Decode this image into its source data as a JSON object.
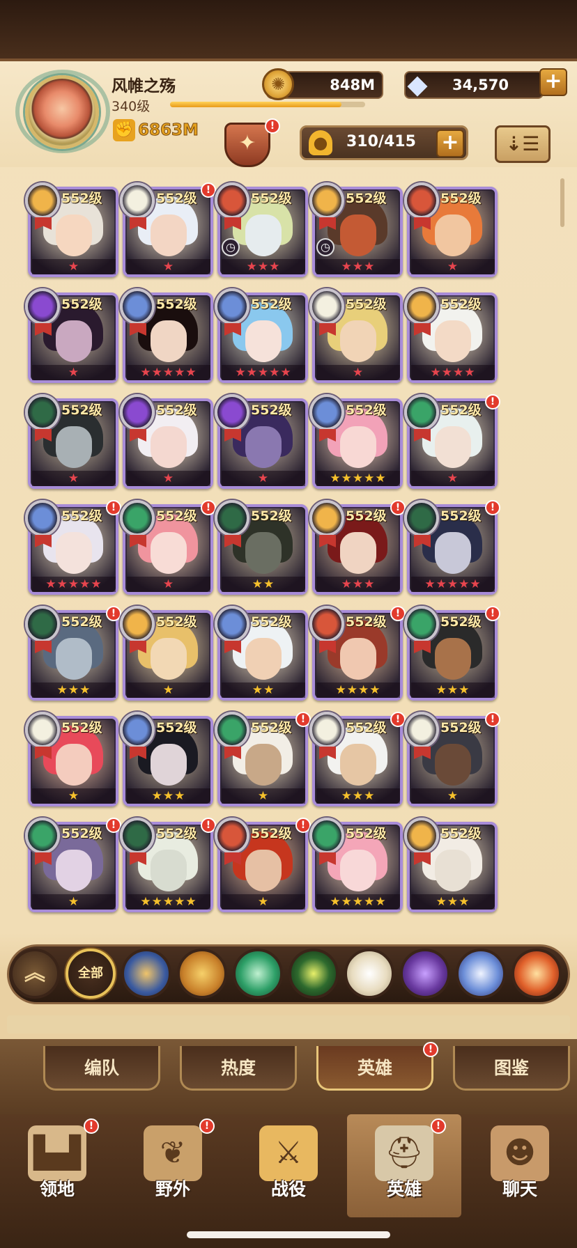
{
  "player": {
    "name": "风帷之殇",
    "level": "340级",
    "xp_fraction": 0.88,
    "power": "6863M"
  },
  "resources": {
    "gold": "848M",
    "diamonds": "34,570",
    "gold_icon": "gold-coin-icon",
    "diamond_icon": "diamond-icon"
  },
  "hero_count": "310/415",
  "faction_colors": {
    "lightbearer": "#f0b44a",
    "mauler": "#d8563a",
    "wilder": "#3aa468",
    "graveborn": "#8a4ad0",
    "celestial": "#f3f0e0",
    "hypogean": "#6a3aa0",
    "dimensional": "#6c8ed8",
    "dragon": "#2f6a46"
  },
  "heroes": [
    {
      "level": "552级",
      "stars": "★",
      "star_color": "red",
      "faction": "lightbearer",
      "badge": false,
      "clock": false,
      "skin": "#f6d7c0",
      "hair": "#e8e2d8"
    },
    {
      "level": "552级",
      "stars": "★",
      "star_color": "red",
      "faction": "celestial",
      "badge": true,
      "clock": false,
      "skin": "#f3d6c4",
      "hair": "#e9eef6"
    },
    {
      "level": "552级",
      "stars": "★★★",
      "star_color": "red",
      "faction": "mauler",
      "badge": false,
      "clock": true,
      "skin": "#e6ecee",
      "hair": "#d8e2a8"
    },
    {
      "level": "552级",
      "stars": "★★★",
      "star_color": "red",
      "faction": "lightbearer",
      "badge": false,
      "clock": true,
      "skin": "#c45a34",
      "hair": "#5a3a2a"
    },
    {
      "level": "552级",
      "stars": "★",
      "star_color": "red",
      "faction": "mauler",
      "badge": false,
      "clock": false,
      "skin": "#f1c6a0",
      "hair": "#e87a3a"
    },
    {
      "level": "552级",
      "stars": "★",
      "star_color": "red",
      "faction": "graveborn",
      "badge": false,
      "clock": false,
      "skin": "#c9a8c0",
      "hair": "#2a1a2e"
    },
    {
      "level": "552级",
      "stars": "★★★★★",
      "star_color": "red",
      "faction": "dimensional",
      "badge": false,
      "clock": false,
      "skin": "#f0d6c4",
      "hair": "#1a0e0e"
    },
    {
      "level": "552级",
      "stars": "★★★★★",
      "star_color": "red",
      "faction": "dimensional",
      "badge": false,
      "clock": false,
      "skin": "#f6e2da",
      "hair": "#8ac8ee"
    },
    {
      "level": "552级",
      "stars": "★",
      "star_color": "red",
      "faction": "celestial",
      "badge": false,
      "clock": false,
      "skin": "#f1d4b6",
      "hair": "#e8cf7a"
    },
    {
      "level": "552级",
      "stars": "★★★★",
      "star_color": "red",
      "faction": "lightbearer",
      "badge": false,
      "clock": false,
      "skin": "#f3dac6",
      "hair": "#f2f2ee"
    },
    {
      "level": "552级",
      "stars": "★",
      "star_color": "red",
      "faction": "dragon",
      "badge": false,
      "clock": false,
      "skin": "#a8b0b4",
      "hair": "#2a2e30"
    },
    {
      "level": "552级",
      "stars": "★",
      "star_color": "red",
      "faction": "graveborn",
      "badge": false,
      "clock": false,
      "skin": "#f4d8d0",
      "hair": "#f2eef2"
    },
    {
      "level": "552级",
      "stars": "★",
      "star_color": "red",
      "faction": "graveborn",
      "badge": false,
      "clock": false,
      "skin": "#8a78b0",
      "hair": "#3a2a5e"
    },
    {
      "level": "552级",
      "stars": "★★★★★",
      "star_color": "gold",
      "faction": "dimensional",
      "badge": false,
      "clock": false,
      "skin": "#f8d8d4",
      "hair": "#f2a2b8"
    },
    {
      "level": "552级",
      "stars": "★",
      "star_color": "red",
      "faction": "wilder",
      "badge": true,
      "clock": false,
      "skin": "#f2e0d4",
      "hair": "#e8f0ee"
    },
    {
      "level": "552级",
      "stars": "★★★★★",
      "star_color": "red",
      "faction": "dimensional",
      "badge": true,
      "clock": false,
      "skin": "#f4e2dc",
      "hair": "#e8e4ee"
    },
    {
      "level": "552级",
      "stars": "★",
      "star_color": "red",
      "faction": "wilder",
      "badge": true,
      "clock": false,
      "skin": "#f8dcd6",
      "hair": "#f0949e"
    },
    {
      "level": "552级",
      "stars": "★★",
      "star_color": "gold",
      "faction": "dragon",
      "badge": false,
      "clock": false,
      "skin": "#6a6e62",
      "hair": "#2e3228"
    },
    {
      "level": "552级",
      "stars": "★★★",
      "star_color": "red",
      "faction": "lightbearer",
      "badge": true,
      "clock": false,
      "skin": "#f0d4c2",
      "hair": "#7a1a1a"
    },
    {
      "level": "552级",
      "stars": "★★★★★",
      "star_color": "red",
      "faction": "dragon",
      "badge": true,
      "clock": false,
      "skin": "#c8c8d8",
      "hair": "#2a2e4a"
    },
    {
      "level": "552级",
      "stars": "★★★",
      "star_color": "gold",
      "faction": "dragon",
      "badge": true,
      "clock": false,
      "skin": "#b0bcc8",
      "hair": "#5a6a80"
    },
    {
      "level": "552级",
      "stars": "★",
      "star_color": "gold",
      "faction": "lightbearer",
      "badge": false,
      "clock": false,
      "skin": "#f2d8b4",
      "hair": "#e8c06a"
    },
    {
      "level": "552级",
      "stars": "★★",
      "star_color": "gold",
      "faction": "dimensional",
      "badge": false,
      "clock": false,
      "skin": "#f0d0b4",
      "hair": "#eef2f4"
    },
    {
      "level": "552级",
      "stars": "★★★★",
      "star_color": "gold",
      "faction": "mauler",
      "badge": true,
      "clock": false,
      "skin": "#f0c8b0",
      "hair": "#9a3a2a"
    },
    {
      "level": "552级",
      "stars": "★★★",
      "star_color": "gold",
      "faction": "wilder",
      "badge": true,
      "clock": false,
      "skin": "#a8724a",
      "hair": "#2a2a2a"
    },
    {
      "level": "552级",
      "stars": "★",
      "star_color": "gold",
      "faction": "celestial",
      "badge": false,
      "clock": false,
      "skin": "#f4ccbe",
      "hair": "#e84a5a"
    },
    {
      "level": "552级",
      "stars": "★★★",
      "star_color": "gold",
      "faction": "dimensional",
      "badge": false,
      "clock": false,
      "skin": "#e0d4d8",
      "hair": "#1a1a22"
    },
    {
      "level": "552级",
      "stars": "★",
      "star_color": "gold",
      "faction": "wilder",
      "badge": true,
      "clock": false,
      "skin": "#c8a888",
      "hair": "#f2eee6"
    },
    {
      "level": "552级",
      "stars": "★★★",
      "star_color": "gold",
      "faction": "celestial",
      "badge": true,
      "clock": false,
      "skin": "#e6c6a4",
      "hair": "#f2f2f0"
    },
    {
      "level": "552级",
      "stars": "★",
      "star_color": "gold",
      "faction": "celestial",
      "badge": true,
      "clock": false,
      "skin": "#6a4a38",
      "hair": "#3a3a44"
    },
    {
      "level": "552级",
      "stars": "★",
      "star_color": "gold",
      "faction": "wilder",
      "badge": true,
      "clock": false,
      "skin": "#e2d2e4",
      "hair": "#7a6a9a"
    },
    {
      "level": "552级",
      "stars": "★★★★★",
      "star_color": "gold",
      "faction": "dragon",
      "badge": true,
      "clock": false,
      "skin": "#d8dcd0",
      "hair": "#e8ece0"
    },
    {
      "level": "552级",
      "stars": "★",
      "star_color": "gold",
      "faction": "mauler",
      "badge": true,
      "clock": false,
      "skin": "#e6c0a4",
      "hair": "#c6361e"
    },
    {
      "level": "552级",
      "stars": "★★★★★",
      "star_color": "gold",
      "faction": "wilder",
      "badge": false,
      "clock": false,
      "skin": "#f8d8d8",
      "hair": "#f4a6b8"
    },
    {
      "level": "552级",
      "stars": "★★★",
      "star_color": "gold",
      "faction": "lightbearer",
      "badge": false,
      "clock": false,
      "skin": "#e8e0d4",
      "hair": "#f2ece4"
    }
  ],
  "filters": [
    {
      "id": "up",
      "label": "",
      "icon": "chevron-up-icon"
    },
    {
      "id": "all",
      "label": "全部",
      "icon": "",
      "active": true
    },
    {
      "id": "lightbearer",
      "label": "",
      "icon": "lightbearer-icon"
    },
    {
      "id": "mauler-gold",
      "label": "",
      "icon": "mauler-icon"
    },
    {
      "id": "wilder",
      "label": "",
      "icon": "wilder-icon"
    },
    {
      "id": "graveborn-eye",
      "label": "",
      "icon": "graveborn-icon"
    },
    {
      "id": "celestial",
      "label": "",
      "icon": "celestial-icon"
    },
    {
      "id": "hypogean",
      "label": "",
      "icon": "hypogean-icon"
    },
    {
      "id": "dimensional",
      "label": "",
      "icon": "dimensional-icon"
    },
    {
      "id": "dragon",
      "label": "",
      "icon": "dragon-icon"
    }
  ],
  "tabs": [
    {
      "label": "编队",
      "active": false,
      "badge": false
    },
    {
      "label": "热度",
      "active": false,
      "badge": false
    },
    {
      "label": "英雄",
      "active": true,
      "badge": true
    },
    {
      "label": "图鉴",
      "active": false,
      "badge": false
    }
  ],
  "nav": [
    {
      "label": "领地",
      "icon": "castle-icon",
      "badge": true,
      "active": false
    },
    {
      "label": "野外",
      "icon": "scroll-map-icon",
      "badge": true,
      "active": false
    },
    {
      "label": "战役",
      "icon": "sword-emblem-icon",
      "badge": false,
      "active": false
    },
    {
      "label": "英雄",
      "icon": "helmet-icon",
      "badge": true,
      "active": true
    },
    {
      "label": "聊天",
      "icon": "chat-icon",
      "badge": false,
      "active": false
    }
  ]
}
